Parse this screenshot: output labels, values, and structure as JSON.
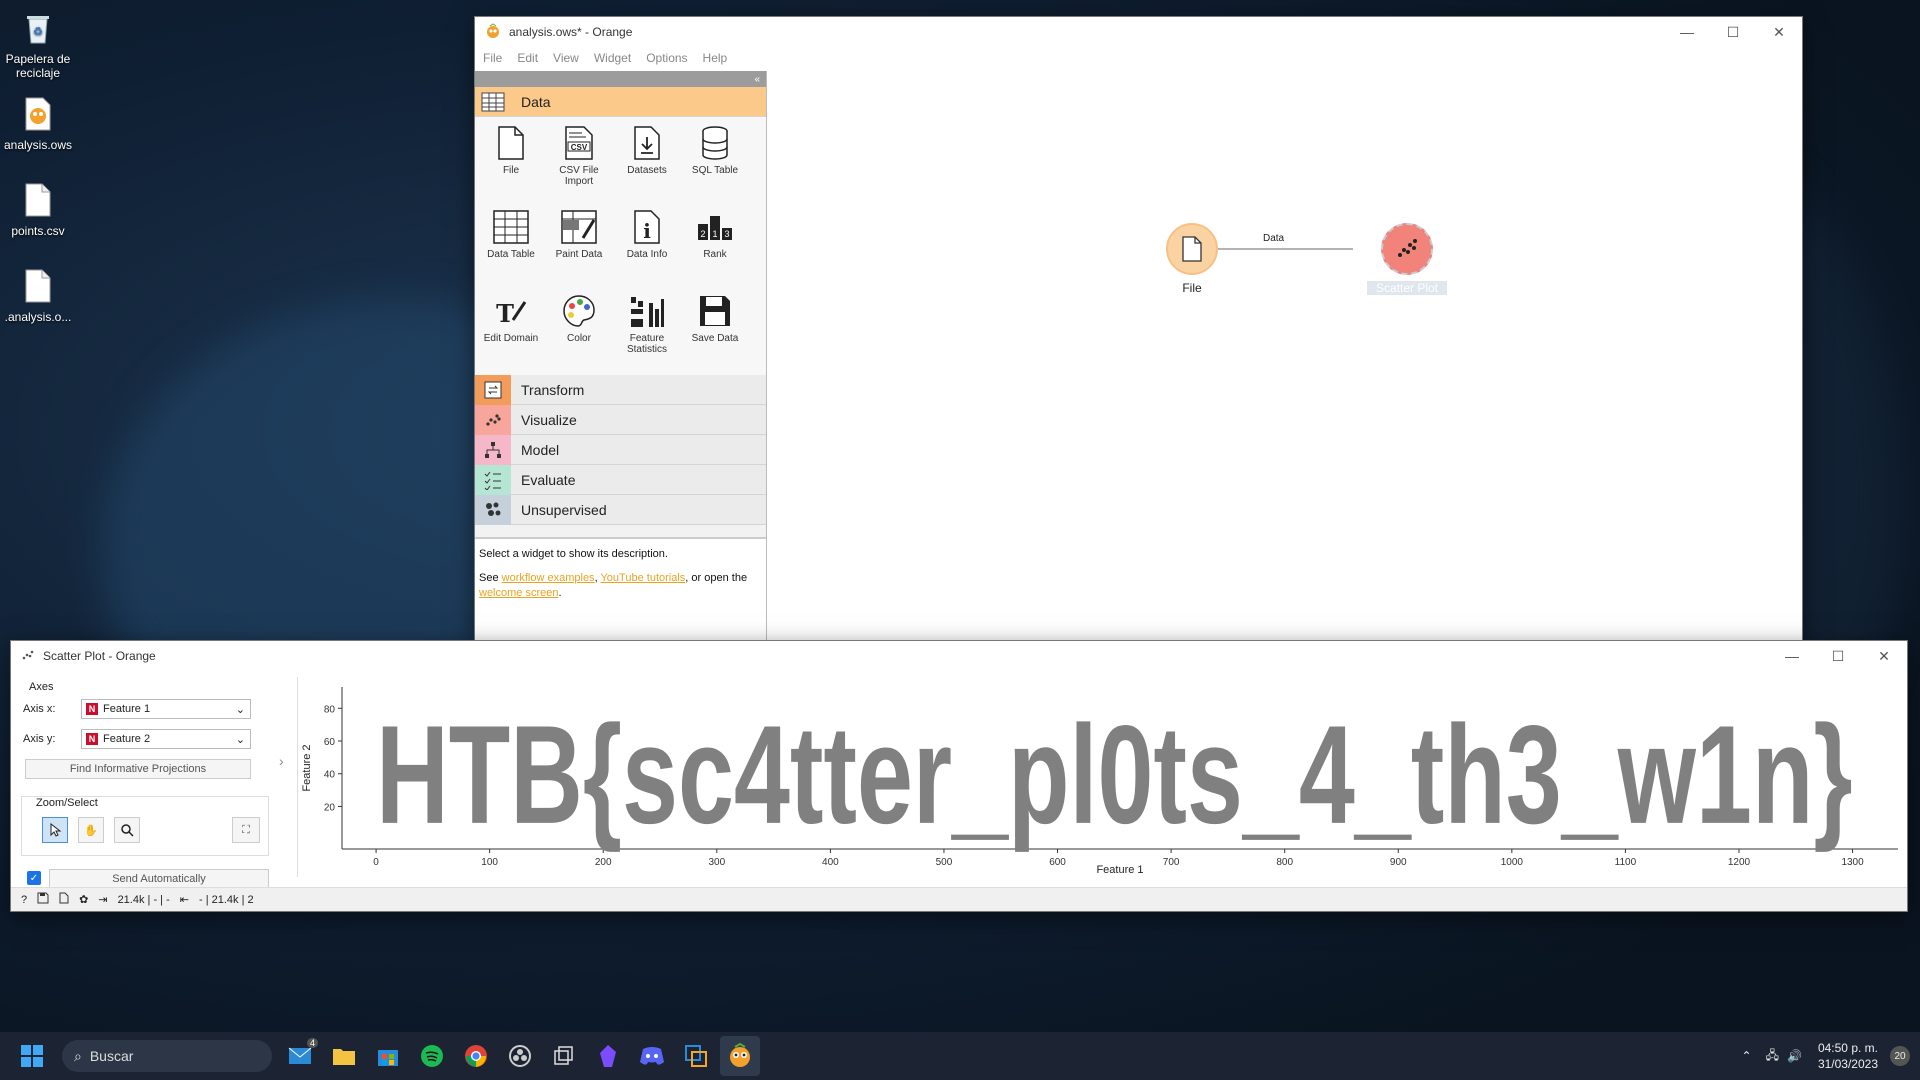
{
  "desktop": {
    "icons": [
      {
        "label": "Papelera de reciclaje"
      },
      {
        "label": "analysis.ows"
      },
      {
        "label": "points.csv"
      },
      {
        "label": ".analysis.o..."
      }
    ]
  },
  "main_window": {
    "title": "analysis.ows* - Orange",
    "menu": [
      "File",
      "Edit",
      "View",
      "Widget",
      "Options",
      "Help"
    ],
    "toolbox": {
      "categories": [
        {
          "label": "Data",
          "color": "#fbc98a"
        },
        {
          "label": "Transform",
          "color": "#f39c5a"
        },
        {
          "label": "Visualize",
          "color": "#f8a69c"
        },
        {
          "label": "Model",
          "color": "#f6b8c8"
        },
        {
          "label": "Evaluate",
          "color": "#b5e6d4"
        },
        {
          "label": "Unsupervised",
          "color": "#c6d0db"
        }
      ],
      "data_widgets": [
        {
          "label": "File",
          "icon": "file-icon"
        },
        {
          "label": "CSV File Import",
          "icon": "csv-icon"
        },
        {
          "label": "Datasets",
          "icon": "datasets-icon"
        },
        {
          "label": "SQL Table",
          "icon": "database-icon"
        },
        {
          "label": "Data Table",
          "icon": "table-icon"
        },
        {
          "label": "Paint Data",
          "icon": "paint-icon"
        },
        {
          "label": "Data Info",
          "icon": "info-icon"
        },
        {
          "label": "Rank",
          "icon": "rank-icon"
        },
        {
          "label": "Edit Domain",
          "icon": "edit-domain-icon"
        },
        {
          "label": "Color",
          "icon": "palette-icon"
        },
        {
          "label": "Feature Statistics",
          "icon": "statistics-icon"
        },
        {
          "label": "Save Data",
          "icon": "save-icon"
        }
      ],
      "description": {
        "line1": "Select a widget to show its description.",
        "see": "See ",
        "link1": "workflow examples",
        "comma": ", ",
        "link2": "YouTube tutorials",
        "mid": ", or open the",
        "link3": "welcome screen",
        "end": "."
      }
    },
    "canvas": {
      "link_label": "Data",
      "nodes": [
        {
          "label": "File"
        },
        {
          "label": "Scatter Plot"
        }
      ]
    }
  },
  "scatter_window": {
    "title": "Scatter Plot - Orange",
    "axes_label": "Axes",
    "axis_x_label": "Axis x:",
    "axis_x_value": "Feature 1",
    "axis_y_label": "Axis y:",
    "axis_y_value": "Feature 2",
    "find_button": "Find Informative Projections",
    "zoom_label": "Zoom/Select",
    "send_auto": "Send Automatically",
    "status_in": "21.4k | - | -",
    "status_out": "- | 21.4k | 2"
  },
  "chart_data": {
    "type": "scatter",
    "xlabel": "Feature 1",
    "ylabel": "Feature 2",
    "xlim": [
      -30,
      1340
    ],
    "ylim": [
      -6,
      93
    ],
    "x_ticks": [
      0,
      100,
      200,
      300,
      400,
      500,
      600,
      700,
      800,
      900,
      1000,
      1100,
      1200,
      1300
    ],
    "y_ticks": [
      20,
      40,
      60,
      80
    ],
    "rendered_text": "HTB{sc4tter_pl0ts_4_th3_w1n}",
    "point_color": "#808080"
  },
  "taskbar": {
    "search_placeholder": "Buscar",
    "mail_badge": "4",
    "time": "04:50 p. m.",
    "date": "31/03/2023",
    "notif_badge": "20"
  }
}
